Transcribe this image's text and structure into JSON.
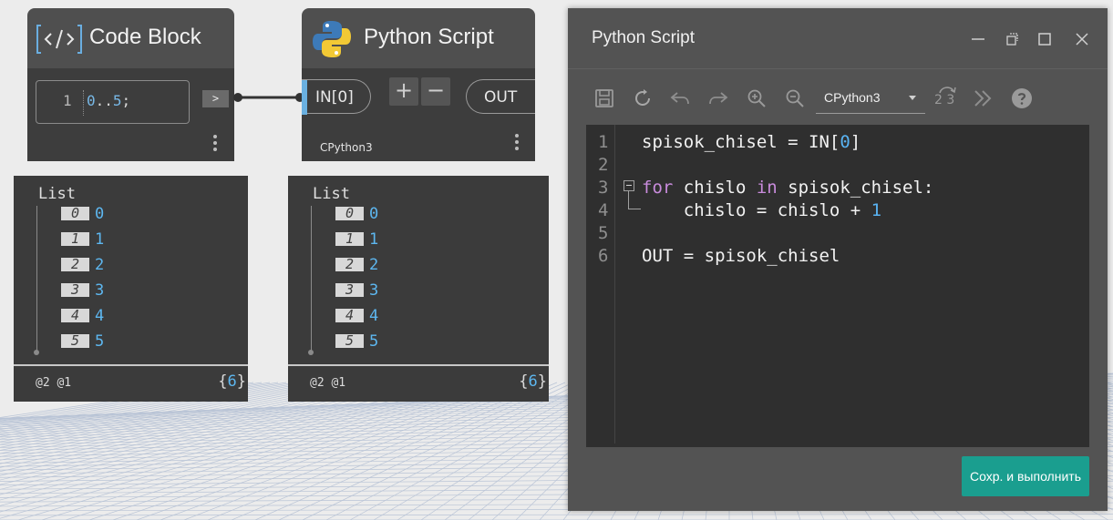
{
  "canvas": {
    "background": "#ececec",
    "grid_color": "#b9c4d6"
  },
  "code_block_node": {
    "title": "Code Block",
    "line_number": "1",
    "code_value": "0",
    "code_dots": "..",
    "code_end": "5",
    "code_semicolon": ";",
    "output_port": ">"
  },
  "python_node": {
    "title": "Python Script",
    "input_port": "IN[0]",
    "add_label": "+",
    "remove_label": "−",
    "output_port": "OUT",
    "engine": "CPython3"
  },
  "preview_code_block": {
    "list_label": "List",
    "items": [
      {
        "index": "0",
        "value": "0"
      },
      {
        "index": "1",
        "value": "1"
      },
      {
        "index": "2",
        "value": "2"
      },
      {
        "index": "3",
        "value": "3"
      },
      {
        "index": "4",
        "value": "4"
      },
      {
        "index": "5",
        "value": "5"
      }
    ],
    "levels": "@2 @1",
    "count_open": "{",
    "count": "6",
    "count_close": "}"
  },
  "preview_python": {
    "list_label": "List",
    "items": [
      {
        "index": "0",
        "value": "0"
      },
      {
        "index": "1",
        "value": "1"
      },
      {
        "index": "2",
        "value": "2"
      },
      {
        "index": "3",
        "value": "3"
      },
      {
        "index": "4",
        "value": "4"
      },
      {
        "index": "5",
        "value": "5"
      }
    ],
    "levels": "@2 @1",
    "count_open": "{",
    "count": "6",
    "count_close": "}"
  },
  "editor": {
    "title": "Python Script",
    "engine_selected": "CPython3",
    "migration_label": "2 3",
    "run_button": "Сохр. и выполнить",
    "line_numbers": [
      "1",
      "2",
      "3",
      "4",
      "5",
      "6"
    ],
    "code": {
      "l1_a": "spisok_chisel = IN[",
      "l1_num": "0",
      "l1_b": "]",
      "l3_kw1": "for",
      "l3_a": " chislo ",
      "l3_kw2": "in",
      "l3_b": " spisok_chisel:",
      "l4_a": "    chislo = chislo + ",
      "l4_num": "1",
      "l6": "OUT = spisok_chisel"
    },
    "icons": [
      "save-icon",
      "reset-icon",
      "undo-icon",
      "redo-icon",
      "zoom-in-icon",
      "zoom-out-icon",
      "migration-icon",
      "more-icon",
      "help-icon"
    ],
    "accent_color": "#1a9e8f"
  }
}
